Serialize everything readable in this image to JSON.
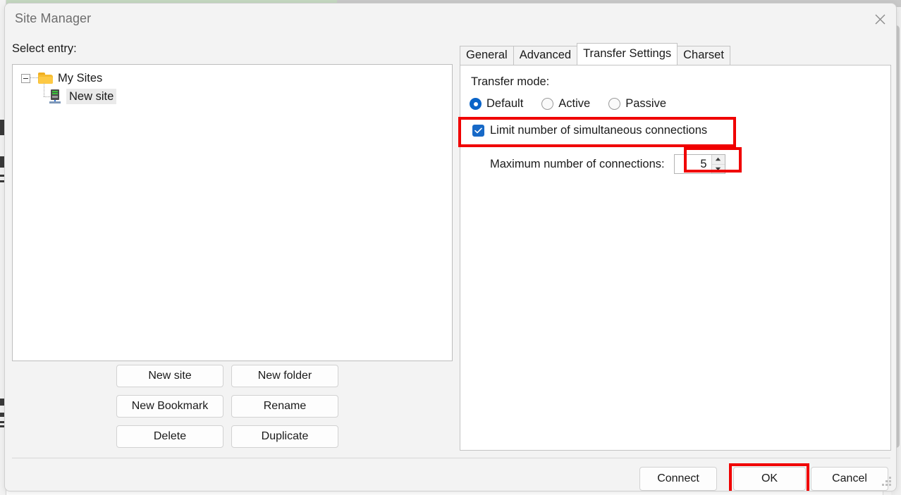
{
  "window": {
    "title": "Site Manager",
    "close_icon": "close-icon"
  },
  "left_pane": {
    "select_entry_label": "Select entry:",
    "tree": {
      "root": {
        "label": "My Sites",
        "icon": "folder-icon",
        "expanded": true,
        "expander_glyph": "−"
      },
      "children": [
        {
          "label": "New site",
          "icon": "server-icon",
          "selected": true
        }
      ]
    },
    "buttons": [
      {
        "label": "New site"
      },
      {
        "label": "New folder"
      },
      {
        "label": "New Bookmark"
      },
      {
        "label": "Rename"
      },
      {
        "label": "Delete"
      },
      {
        "label": "Duplicate"
      }
    ]
  },
  "right_pane": {
    "tabs": [
      {
        "label": "General",
        "active": false
      },
      {
        "label": "Advanced",
        "active": false
      },
      {
        "label": "Transfer Settings",
        "active": true
      },
      {
        "label": "Charset",
        "active": false
      }
    ],
    "transfer_mode": {
      "label": "Transfer mode:",
      "options": [
        {
          "label": "Default",
          "selected": true
        },
        {
          "label": "Active",
          "selected": false
        },
        {
          "label": "Passive",
          "selected": false
        }
      ]
    },
    "limit_connections": {
      "label": "Limit number of simultaneous connections",
      "checked": true,
      "highlighted": true
    },
    "max_connections": {
      "label": "Maximum number of connections:",
      "value": "5",
      "highlighted": true,
      "up_icon": "chevron-up-icon",
      "down_icon": "chevron-down-icon"
    }
  },
  "footer": {
    "buttons": [
      {
        "label": "Connect",
        "highlighted": false
      },
      {
        "label": "OK",
        "highlighted": true
      },
      {
        "label": "Cancel",
        "highlighted": false
      }
    ]
  },
  "colors": {
    "highlight": "#f00000",
    "accent": "#1769c7",
    "radio_accent": "#0a64c8",
    "dialog_bg": "#f3f3f3",
    "panel_bg": "#ffffff",
    "folder": "#f6bc31"
  }
}
